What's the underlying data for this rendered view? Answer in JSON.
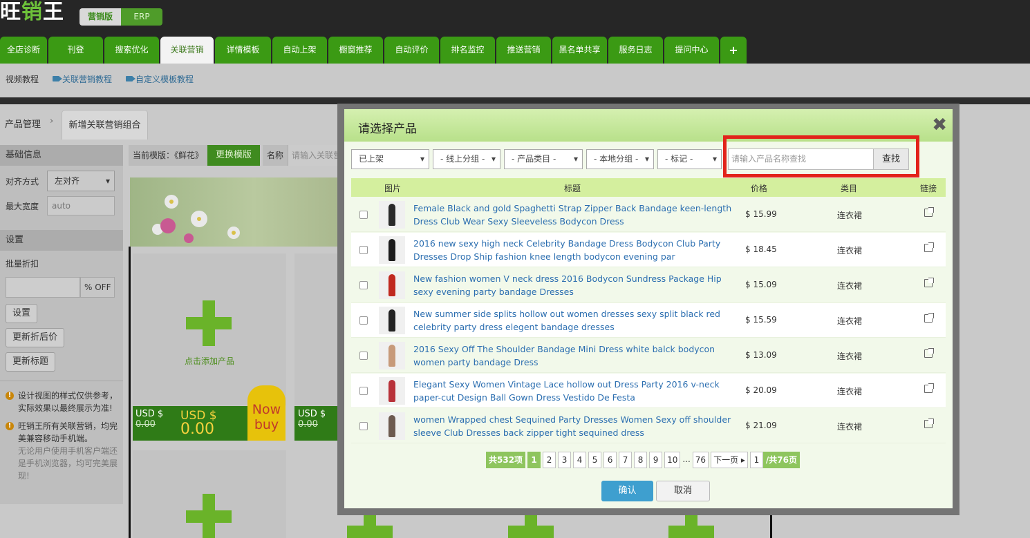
{
  "app": {
    "logo": {
      "part1": "旺",
      "part2": "销",
      "part3": "王"
    },
    "edition_tabs": [
      "营销版",
      "ERP"
    ]
  },
  "nav_tabs": [
    {
      "label": "全店诊断",
      "w": 68
    },
    {
      "label": "刊登",
      "w": 79
    },
    {
      "label": "搜索优化",
      "w": 79
    },
    {
      "label": "关联营销",
      "w": 77,
      "active": true
    },
    {
      "label": "详情模板",
      "w": 81
    },
    {
      "label": "自动上架",
      "w": 79
    },
    {
      "label": "橱窗推荐",
      "w": 79
    },
    {
      "label": "自动评价",
      "w": 79
    },
    {
      "label": "排名监控",
      "w": 79
    },
    {
      "label": "推送营销",
      "w": 79
    },
    {
      "label": "黑名单共享",
      "w": 79
    },
    {
      "label": "服务日志",
      "w": 79
    },
    {
      "label": "提问中心",
      "w": 79
    },
    {
      "label": "+",
      "w": 38
    }
  ],
  "subnav": {
    "video": "视频教程",
    "link1": "关联营销教程",
    "link2": "自定义模板教程"
  },
  "breadcrumb": {
    "root": "产品管理",
    "sep": "›",
    "current": "新增关联营销组合"
  },
  "left_panel": {
    "basic_title": "基础信息",
    "align_label": "对齐方式",
    "align_value": "左对齐",
    "width_label": "最大宽度",
    "width_placeholder": "auto",
    "settings_title": "设置",
    "discount_label": "批量折扣",
    "off_label": "% OFF",
    "set_btn": "设置",
    "update_price_btn": "更新折后价",
    "update_title_btn": "更新标题",
    "info1": "设计视图的样式仅供参考，实际效果以最终展示为准!",
    "info2_a": "旺销王所有关联营销，均完美兼容移动手机端。",
    "info2_b": "无论用户使用手机客户端还是手机浏览器，均可完美展现!"
  },
  "canvas": {
    "template_label": "当前模版：《鲜花》",
    "change_btn": "更换模版",
    "name_label": "名称",
    "name_placeholder": "请输入关联营",
    "add_product": "点击添加产品",
    "usd_small": "USD $",
    "usd_small_val": "0.00",
    "usd_big": "USD $",
    "usd_big_val": "0.00",
    "now": "Now",
    "buy": "buy"
  },
  "modal": {
    "title": "请选择产品",
    "close": "✖",
    "filters": [
      {
        "label": "已上架",
        "w": 113
      },
      {
        "label": "- 线上分组 -",
        "w": 98
      },
      {
        "label": "- 产品类目 -",
        "w": 114
      },
      {
        "label": "- 本地分组 -",
        "w": 98
      },
      {
        "label": "- 标记 -",
        "w": 93
      }
    ],
    "search_placeholder": "请输入产品名称查找",
    "search_btn": "查找",
    "columns": {
      "image": "图片",
      "title": "标题",
      "price": "价格",
      "category": "类目",
      "link": "链接"
    },
    "products": [
      {
        "title": "Female Black and gold Spaghetti Strap Zipper Back Bandage keen-length Dress Club Wear Sexy Sleeveless Bodycon Dress",
        "price": "$ 15.99",
        "category": "连衣裙",
        "color": "#2a2a2a"
      },
      {
        "title": "2016 new sexy high neck Celebrity Bandage Dress Bodycon Club Party Dresses Drop Ship fashion knee length bodycon evening par",
        "price": "$ 18.45",
        "category": "连衣裙",
        "color": "#1c1c1c"
      },
      {
        "title": "New fashion women V neck dress 2016 Bodycon Sundress Package Hip sexy evening party bandage Dresses",
        "price": "$ 15.09",
        "category": "连衣裙",
        "color": "#c0281f"
      },
      {
        "title": "New summer side splits hollow out women dresses sexy split black red celebrity party dress elegent bandage dresses",
        "price": "$ 15.59",
        "category": "连衣裙",
        "color": "#222222"
      },
      {
        "title": "2016 Sexy Off The Shoulder Bandage Mini Dress white balck bodycon women party bandage Dress",
        "price": "$ 13.09",
        "category": "连衣裙",
        "color": "#c79a7a"
      },
      {
        "title": "Elegant Sexy Women Vintage Lace hollow out Dress Party 2016 v-neck paper-cut Design Ball Gown Dress Vestido De Festa",
        "price": "$ 20.09",
        "category": "连衣裙",
        "color": "#b8323a"
      },
      {
        "title": "women Wrapped chest Sequined Party Dresses Women Sexy off shoulder sleeve Club Dresses back zipper tight sequined dress",
        "price": "$ 21.09",
        "category": "连衣裙",
        "color": "#6d5a50"
      }
    ],
    "pager": {
      "total": "共532项",
      "pages": [
        "1",
        "2",
        "3",
        "4",
        "5",
        "6",
        "7",
        "8",
        "9",
        "10"
      ],
      "dots": "...",
      "last": "76",
      "next": "下一页 ▸",
      "current_input": "1",
      "total_pages": "/共76页"
    },
    "confirm": "确认",
    "cancel": "取消"
  },
  "colors": {
    "accent_green": "#3b9a14",
    "highlight_red": "#e2231a",
    "confirm_blue": "#3e9fcf"
  }
}
